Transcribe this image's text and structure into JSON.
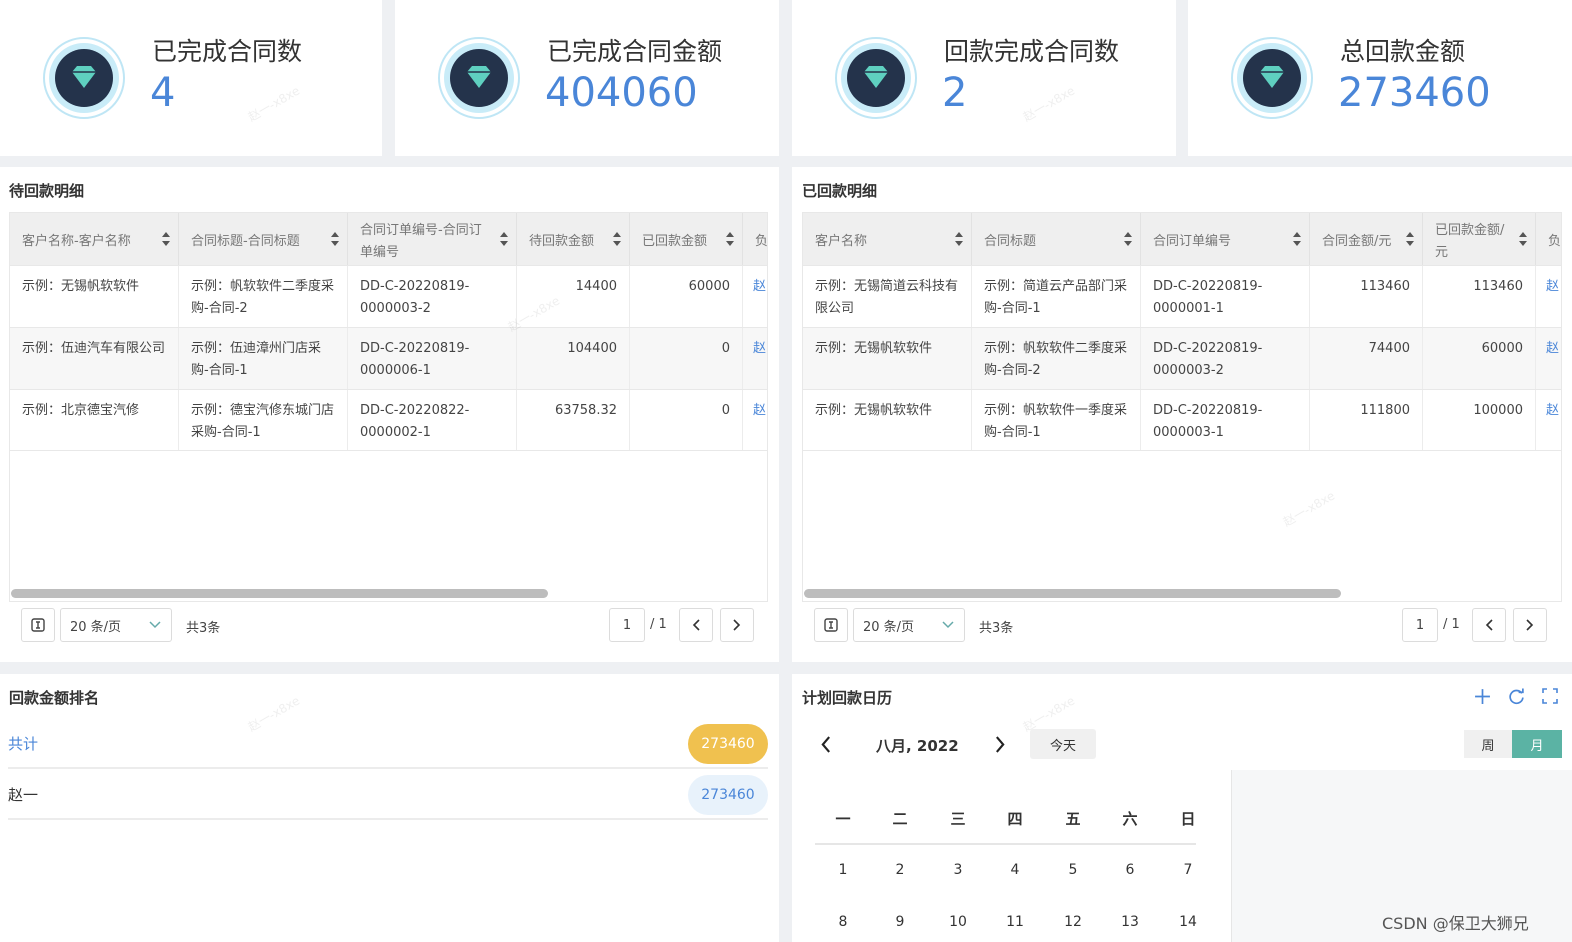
{
  "stats": [
    {
      "label": "已完成合同数",
      "value": "4"
    },
    {
      "label": "已完成合同金额",
      "value": "404060"
    },
    {
      "label": "回款完成合同数",
      "value": "2"
    },
    {
      "label": "总回款金额",
      "value": "273460"
    }
  ],
  "pending": {
    "title": "待回款明细",
    "columns": [
      "客户名称-客户名称",
      "合同标题-合同标题",
      "合同订单编号-合同订单编号",
      "待回款金额",
      "已回款金额",
      "负"
    ],
    "rows": [
      [
        "示例：无锡帆软软件",
        "示例：帆软软件二季度采购-合同-2",
        "DD-C-20220819-0000003-2",
        "14400",
        "60000",
        "赵"
      ],
      [
        "示例：伍迪汽车有限公司",
        "示例：伍迪漳州门店采购-合同-1",
        "DD-C-20220819-0000006-1",
        "104400",
        "0",
        "赵"
      ],
      [
        "示例：北京德宝汽修",
        "示例：德宝汽修东城门店采购-合同-1",
        "DD-C-20220822-0000002-1",
        "63758.32",
        "0",
        "赵"
      ]
    ],
    "page_size": "20 条/页",
    "total": "共3条",
    "page": "1",
    "page_total": "/ 1"
  },
  "paid": {
    "title": "已回款明细",
    "columns": [
      "客户名称",
      "合同标题",
      "合同订单编号",
      "合同金额/元",
      "已回款金额/元",
      "负"
    ],
    "rows": [
      [
        "示例：无锡简道云科技有限公司",
        "示例：简道云产品部门采购-合同-1",
        "DD-C-20220819-0000001-1",
        "113460",
        "113460",
        "赵"
      ],
      [
        "示例：无锡帆软软件",
        "示例：帆软软件二季度采购-合同-2",
        "DD-C-20220819-0000003-2",
        "74400",
        "60000",
        "赵"
      ],
      [
        "示例：无锡帆软软件",
        "示例：帆软软件一季度采购-合同-1",
        "DD-C-20220819-0000003-1",
        "111800",
        "100000",
        "赵"
      ]
    ],
    "page_size": "20 条/页",
    "total": "共3条",
    "page": "1",
    "page_total": "/ 1"
  },
  "ranking": {
    "title": "回款金额排名",
    "rows": [
      {
        "name": "共计",
        "value": "273460"
      },
      {
        "name": "赵一",
        "value": "273460"
      }
    ]
  },
  "calendar": {
    "title": "计划回款日历",
    "month": "八月, 2022",
    "today": "今天",
    "week": "周",
    "month_view": "月",
    "weekdays": [
      "一",
      "二",
      "三",
      "四",
      "五",
      "六",
      "日"
    ],
    "days": [
      "1",
      "2",
      "3",
      "4",
      "5",
      "6",
      "7",
      "8",
      "9",
      "10",
      "11",
      "12",
      "13",
      "14"
    ]
  },
  "watermark": "赵一-x8xe",
  "csdn": "CSDN @保卫大狮兄",
  "colors": {
    "accent": "#4a86d8",
    "gold": "#f0c14f",
    "teal": "#5bb3a4"
  }
}
